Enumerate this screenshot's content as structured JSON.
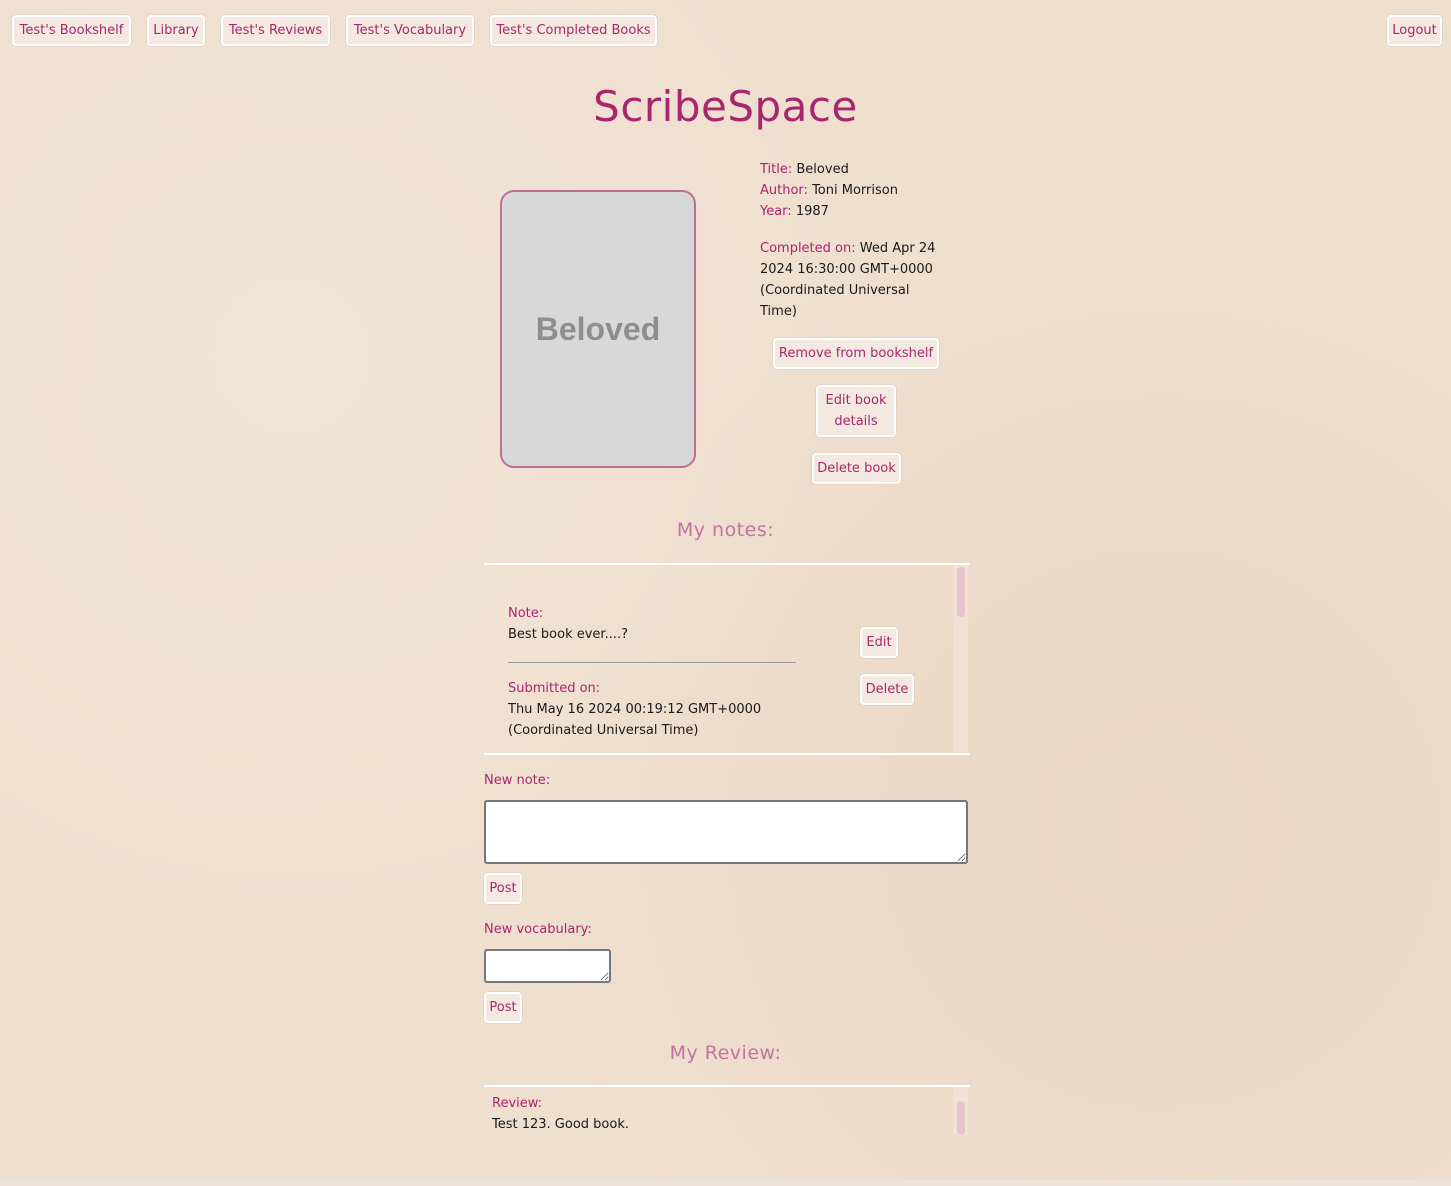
{
  "nav": {
    "bookshelf": "Test's Bookshelf",
    "library": "Library",
    "reviews": "Test's Reviews",
    "vocabulary": "Test's Vocabulary",
    "completed": "Test's Completed Books",
    "logout": "Logout"
  },
  "site_title": "ScribeSpace",
  "book": {
    "cover_text": "Beloved",
    "title_label": "Title:",
    "title": "Beloved",
    "author_label": "Author:",
    "author": "Toni Morrison",
    "year_label": "Year:",
    "year": "1987",
    "completed_label": "Completed on:",
    "completed_line1": "Wed Apr 24",
    "completed_line2": "2024 16:30:00 GMT+0000",
    "completed_line3": "(Coordinated Universal",
    "completed_line4": "Time)"
  },
  "actions": {
    "remove": "Remove from bookshelf",
    "edit_line1": "Edit book",
    "edit_line2": "details",
    "delete": "Delete book"
  },
  "notes": {
    "heading": "My notes:",
    "items": [
      {
        "note_label": "Note:",
        "note_text": "Best book ever....?",
        "submitted_label": "Submitted on:",
        "submitted_line1": "Thu May 16 2024 00:19:12 GMT+0000",
        "submitted_line2": "(Coordinated Universal Time)",
        "edit": "Edit",
        "delete": "Delete"
      }
    ],
    "new_note_label": "New note:",
    "new_note_value": "",
    "post_label": "Post"
  },
  "vocabulary": {
    "new_label": "New vocabulary:",
    "new_value": "",
    "post_label": "Post"
  },
  "review": {
    "heading": "My Review:",
    "label": "Review:",
    "text": "Test 123. Good book."
  },
  "colors": {
    "accent": "#a8266e",
    "heading_pink": "#c273a0",
    "background": "#efdfcf",
    "cover_border": "#bd6e93",
    "cover_fill": "#d8d8d8"
  }
}
